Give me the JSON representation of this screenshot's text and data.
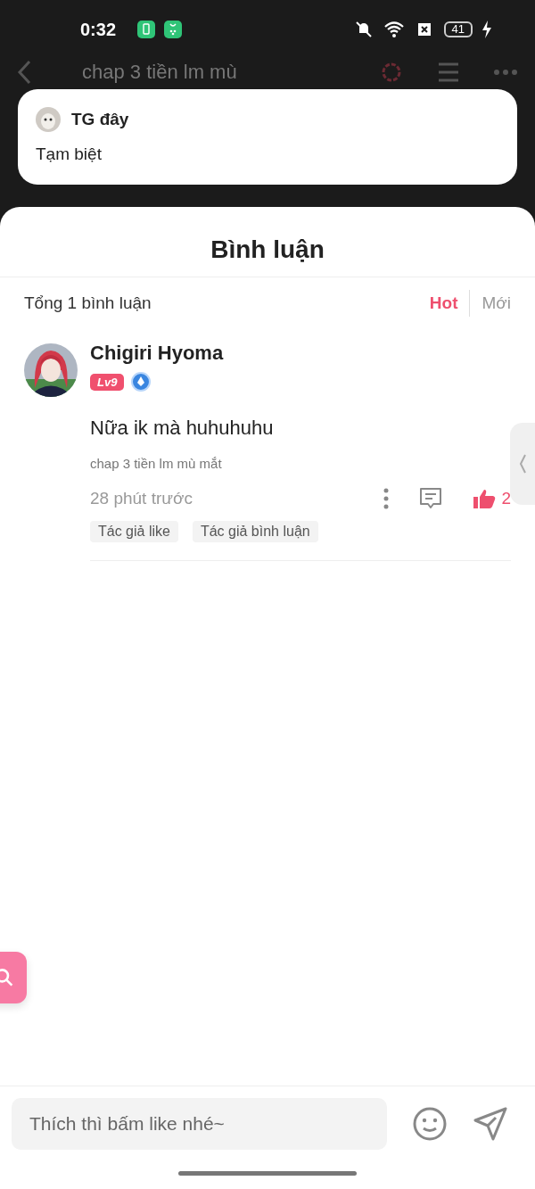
{
  "status_bar": {
    "time": "0:32",
    "battery": "41"
  },
  "background_header": {
    "title": "chap 3 tiền lm mù"
  },
  "notification": {
    "title": "TG đây",
    "message": "Tạm biệt"
  },
  "sheet": {
    "title": "Bình luận",
    "total": "Tổng 1 bình luận",
    "sort_tabs": [
      {
        "label": "Hot",
        "selected": true
      },
      {
        "label": "Mới",
        "selected": false
      }
    ],
    "comments": [
      {
        "author": "Chigiri Hyoma",
        "level": "Lv9",
        "text": "Nữa ik mà huhuhuhu",
        "chapter": "chap 3 tiền lm mù mắt",
        "time": "28 phút trước",
        "likes": "2",
        "liked": true,
        "tags": [
          "Tác giả like",
          "Tác giả bình luận"
        ]
      }
    ]
  },
  "input": {
    "placeholder": "Thích thì bấm like nhé~"
  }
}
